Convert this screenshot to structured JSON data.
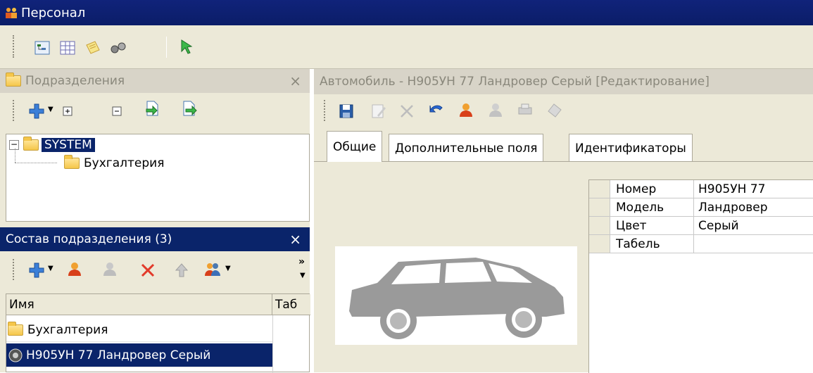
{
  "window": {
    "title": "Персонал"
  },
  "dept_panel": {
    "title": "Подразделения",
    "close": "×"
  },
  "tree": {
    "root": "SYSTEM",
    "child": "Бухгалтерия"
  },
  "members_panel": {
    "title": "Состав подразделения (3)",
    "close": "×",
    "more": "»"
  },
  "grid": {
    "columns": [
      "Имя",
      "Таб"
    ],
    "rows": [
      {
        "name": "Бухгалтерия"
      },
      {
        "name": "Н905УН 77 Ландровер Серый"
      }
    ]
  },
  "editor": {
    "title": "Автомобиль - Н905УН 77 Ландровер Серый [Редактирование]",
    "tabs": [
      "Общие",
      "Дополнительные поля",
      "Идентификаторы"
    ]
  },
  "props": [
    {
      "key": "Номер",
      "value": "Н905УН 77"
    },
    {
      "key": "Модель",
      "value": "Ландровер"
    },
    {
      "key": "Цвет",
      "value": "Серый"
    },
    {
      "key": "Табель",
      "value": ""
    }
  ],
  "colors": {
    "title_bg": "#0a246a",
    "chrome": "#ece9d8",
    "selection": "#0a246a"
  }
}
